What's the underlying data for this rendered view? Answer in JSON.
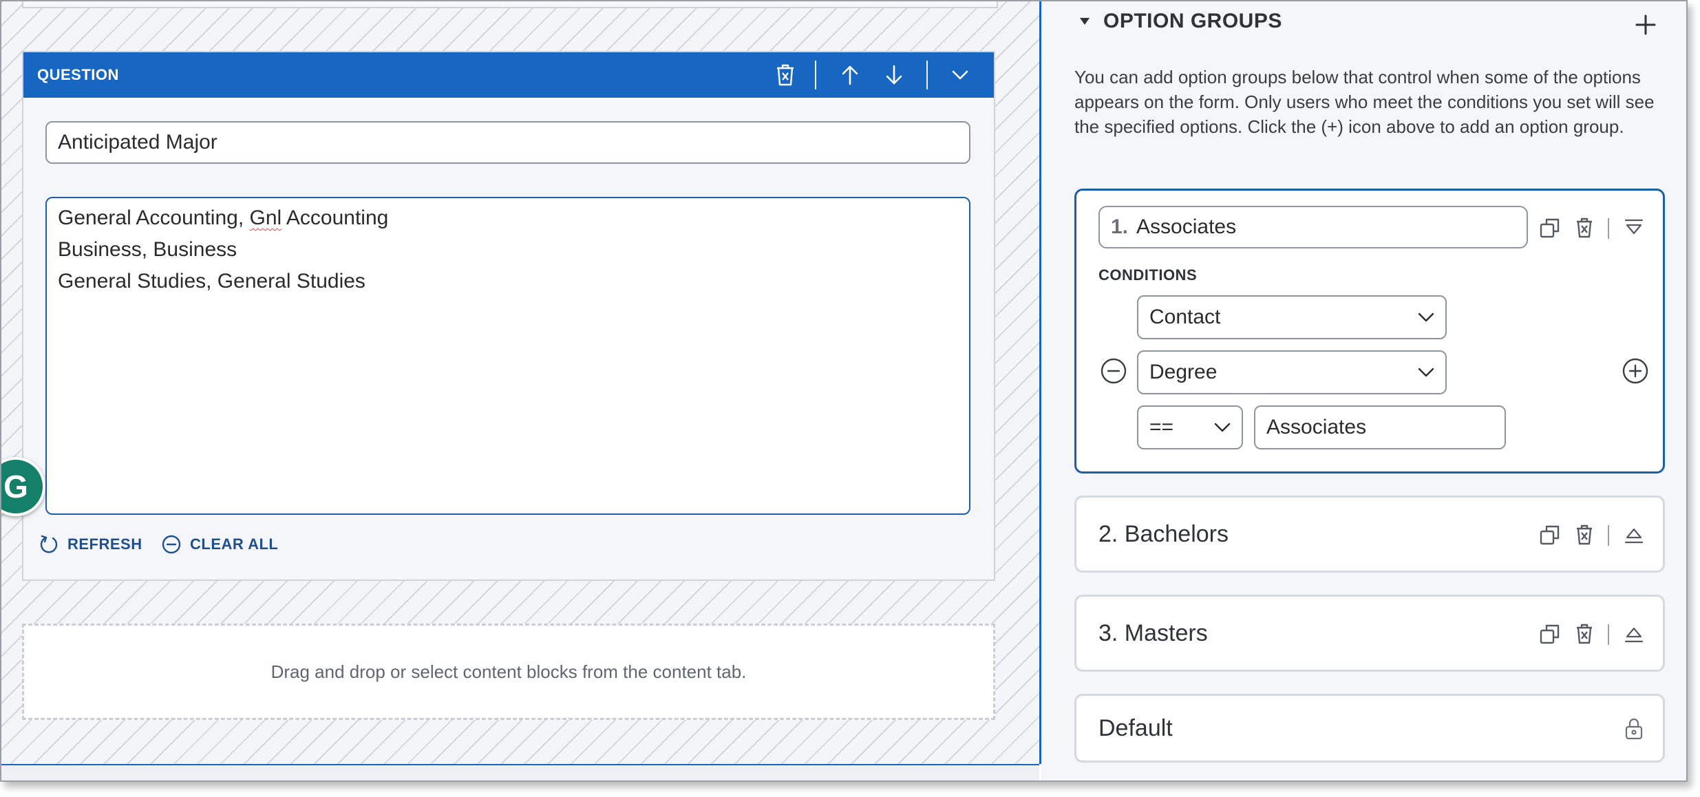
{
  "question": {
    "header_title": "QUESTION",
    "label_value": "Anticipated Major",
    "options_lines": [
      {
        "before": "General Accounting, ",
        "flagged": "Gnl",
        "after": " Accounting"
      },
      {
        "text": "Business, Business"
      },
      {
        "text": "General Studies, General Studies"
      }
    ],
    "refresh_label": "REFRESH",
    "clear_all_label": "CLEAR ALL"
  },
  "dropzone": {
    "text": "Drag and drop or select content blocks from the content tab."
  },
  "grammarly": {
    "letter": "G"
  },
  "option_groups": {
    "title": "OPTION GROUPS",
    "description": "You can add option groups below that control when some of the options appears on the form. Only users who meet the conditions you set will see the specified options. Click the (+) icon above to add an option group.",
    "groups": [
      {
        "number": "1.",
        "name": "Associates",
        "conditions_label": "CONDITIONS",
        "condition": {
          "source": "Contact",
          "field": "Degree",
          "operator": "==",
          "value": "Associates"
        }
      },
      {
        "title": "2. Bachelors"
      },
      {
        "title": "3. Masters"
      },
      {
        "title": "Default"
      }
    ]
  },
  "colors": {
    "header_blue": "#1766c2",
    "active_border": "#1b5fa8",
    "link_text": "#1e4f8f",
    "grammarly_green": "#15806a"
  }
}
